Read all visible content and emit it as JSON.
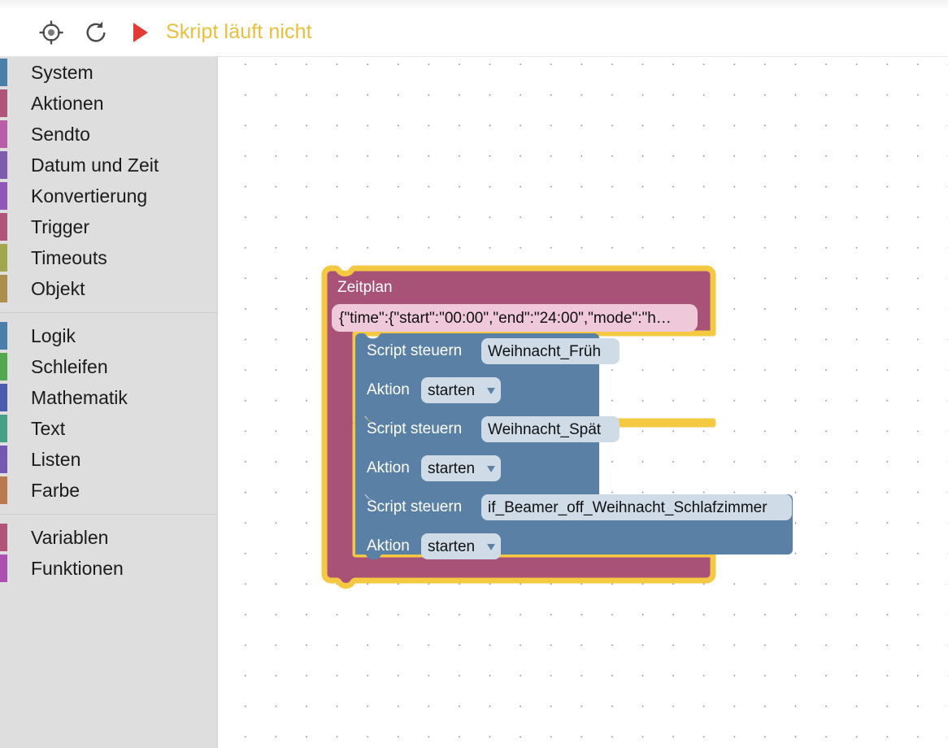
{
  "toolbar": {
    "center_icon": "target-crosshair-icon",
    "reload_icon": "reload-icon",
    "run_icon": "play-icon",
    "status_text": "Skript läuft nicht",
    "status_color": "#e8c03c",
    "play_color": "#e53935"
  },
  "sidebar": {
    "groups": [
      {
        "items": [
          {
            "label": "System",
            "color": "#4a7fad"
          },
          {
            "label": "Aktionen",
            "color": "#b3537a"
          },
          {
            "label": "Sendto",
            "color": "#ba5caa"
          },
          {
            "label": "Datum und Zeit",
            "color": "#7e5bae"
          },
          {
            "label": "Konvertierung",
            "color": "#9057b8"
          },
          {
            "label": "Trigger",
            "color": "#b3537a"
          },
          {
            "label": "Timeouts",
            "color": "#a3a64b"
          },
          {
            "label": "Objekt",
            "color": "#ab8f4b"
          }
        ]
      },
      {
        "items": [
          {
            "label": "Logik",
            "color": "#4a7fad"
          },
          {
            "label": "Schleifen",
            "color": "#51a84f"
          },
          {
            "label": "Mathematik",
            "color": "#4a5bb0"
          },
          {
            "label": "Text",
            "color": "#46a085"
          },
          {
            "label": "Listen",
            "color": "#7558b3"
          },
          {
            "label": "Farbe",
            "color": "#b97a4e"
          }
        ]
      },
      {
        "items": [
          {
            "label": "Variablen",
            "color": "#b3537a"
          },
          {
            "label": "Funktionen",
            "color": "#ab4fb3"
          }
        ]
      }
    ]
  },
  "workspace": {
    "selected_outline_color": "#f5c842",
    "schedule_block": {
      "title": "Zeitplan",
      "block_color": "#a85277",
      "field_value": "{\"time\":{\"start\":\"00:00\",\"end\":\"24:00\",\"mode\":\"h…",
      "field_bg": "#efc8da"
    },
    "statement_color": "#5b80a5",
    "field_bg": "#cfdce8",
    "statements": [
      {
        "label": "Script steuern",
        "script_name": "Weihnacht_Früh",
        "action_label": "Aktion",
        "action_value": "starten"
      },
      {
        "label": "Script steuern",
        "script_name": "Weihnacht_Spät",
        "action_label": "Aktion",
        "action_value": "starten"
      },
      {
        "label": "Script steuern",
        "script_name": "if_Beamer_off_Weihnacht_Schlafzimmer",
        "action_label": "Aktion",
        "action_value": "starten"
      }
    ]
  }
}
